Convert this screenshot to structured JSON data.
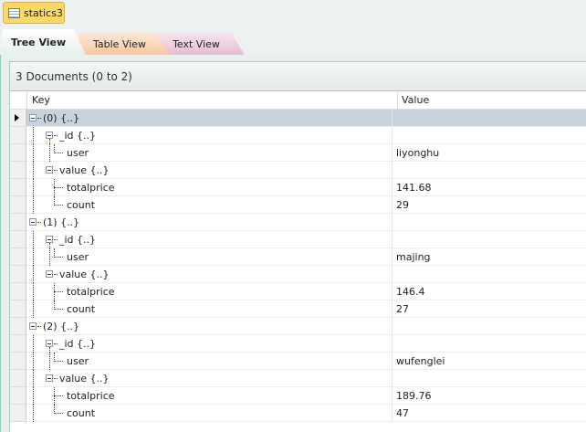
{
  "doc_tab": "statics3",
  "tabs": [
    "Tree View",
    "Table View",
    "Text View"
  ],
  "summary": "3 Documents (0 to 2)",
  "columns": {
    "key": "Key",
    "value": "Value"
  },
  "rows": [
    {
      "key": "(0) {..}",
      "value": "",
      "level": 0,
      "exp": true,
      "sel": true
    },
    {
      "key": "_id {..}",
      "value": "",
      "level": 1,
      "exp": true
    },
    {
      "key": "user",
      "value": "liyonghu",
      "level": 2
    },
    {
      "key": "value {..}",
      "value": "",
      "level": 1,
      "exp": true
    },
    {
      "key": "totalprice",
      "value": "141.68",
      "level": 2
    },
    {
      "key": "count",
      "value": "29",
      "level": 2
    },
    {
      "key": "(1) {..}",
      "value": "",
      "level": 0,
      "exp": true
    },
    {
      "key": "_id {..}",
      "value": "",
      "level": 1,
      "exp": true
    },
    {
      "key": "user",
      "value": "majing",
      "level": 2
    },
    {
      "key": "value {..}",
      "value": "",
      "level": 1,
      "exp": true
    },
    {
      "key": "totalprice",
      "value": "146.4",
      "level": 2
    },
    {
      "key": "count",
      "value": "27",
      "level": 2
    },
    {
      "key": "(2) {..}",
      "value": "",
      "level": 0,
      "exp": true
    },
    {
      "key": "_id {..}",
      "value": "",
      "level": 1,
      "exp": true
    },
    {
      "key": "user",
      "value": "wufenglei",
      "level": 2
    },
    {
      "key": "value {..}",
      "value": "",
      "level": 1,
      "exp": true
    },
    {
      "key": "totalprice",
      "value": "189.76",
      "level": 2
    },
    {
      "key": "count",
      "value": "47",
      "level": 2
    }
  ]
}
